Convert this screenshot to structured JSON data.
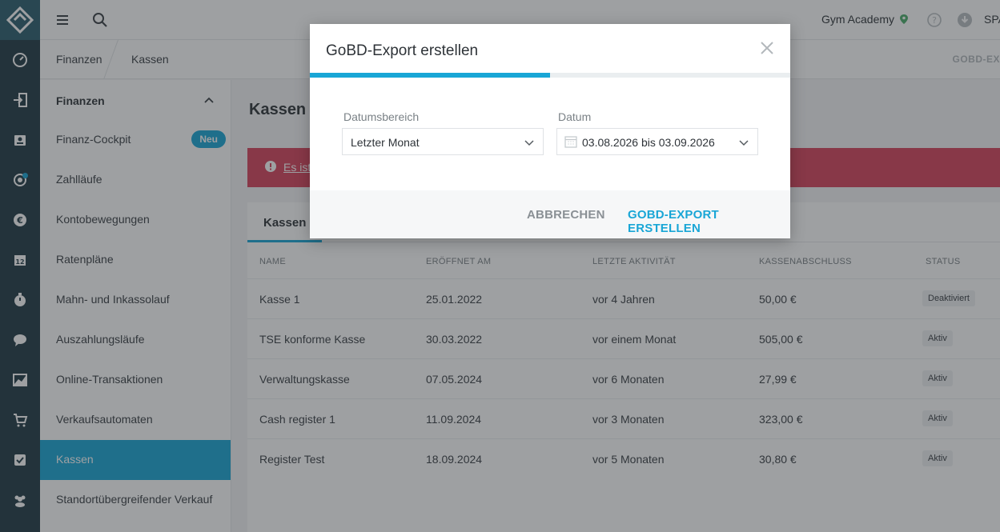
{
  "colors": {
    "accent": "#19a6d6",
    "rail": "#1f3a44",
    "alert": "#d8425c"
  },
  "topbar": {
    "studio": "Gym Academy",
    "user_label": "SPA"
  },
  "breadcrumb": {
    "items": [
      "Finanzen",
      "Kassen"
    ],
    "right_action": "GOBD-EX"
  },
  "rail": {
    "icons": [
      "dashboard-icon",
      "checkin-icon",
      "customers-icon",
      "marketing-icon",
      "finance-icon",
      "calendar-icon",
      "timer-icon",
      "chat-icon",
      "analytics-icon",
      "shop-icon",
      "tasks-icon",
      "staff-icon"
    ]
  },
  "subnav": {
    "title": "Finanzen",
    "items": [
      {
        "label": "Finanz-Cockpit",
        "badge": "Neu"
      },
      {
        "label": "Zahlläufe"
      },
      {
        "label": "Kontobewegungen"
      },
      {
        "label": "Ratenpläne"
      },
      {
        "label": "Mahn- und Inkassolauf"
      },
      {
        "label": "Auszahlungsläufe"
      },
      {
        "label": "Online-Transaktionen"
      },
      {
        "label": "Verkaufsautomaten"
      },
      {
        "label": "Kassen"
      },
      {
        "label": "Standortübergreifender Verkauf"
      }
    ]
  },
  "main": {
    "title": "Kassen",
    "alert_text": "Es ist",
    "tab": "Kassen",
    "table": {
      "headers": [
        "NAME",
        "ERÖFFNET AM",
        "LETZTE AKTIVITÄT",
        "KASSENABSCHLUSS",
        "STATUS"
      ],
      "rows": [
        [
          "Kasse 1",
          "25.01.2022",
          "vor 4 Jahren",
          "50,00 €",
          "Deaktiviert"
        ],
        [
          "TSE konforme Kasse",
          "30.03.2022",
          "vor einem Monat",
          "505,00 €",
          "Aktiv"
        ],
        [
          "Verwaltungskasse",
          "07.05.2024",
          "vor 6 Monaten",
          "27,99 €",
          "Aktiv"
        ],
        [
          "Cash register 1",
          "11.09.2024",
          "vor 3 Monaten",
          "323,00 €",
          "Aktiv"
        ],
        [
          "Register Test",
          "18.09.2024",
          "vor 5 Monaten",
          "30,80 €",
          "Aktiv"
        ]
      ]
    }
  },
  "modal": {
    "title": "GoBD-Export erstellen",
    "progress_fraction": 0.5,
    "date_range_label": "Datumsbereich",
    "date_range_value": "Letzter Monat",
    "date_label": "Datum",
    "date_value": "03.08.2026 bis 03.09.2026",
    "cancel": "ABBRECHEN",
    "submit": "GOBD-EXPORT ERSTELLEN"
  }
}
